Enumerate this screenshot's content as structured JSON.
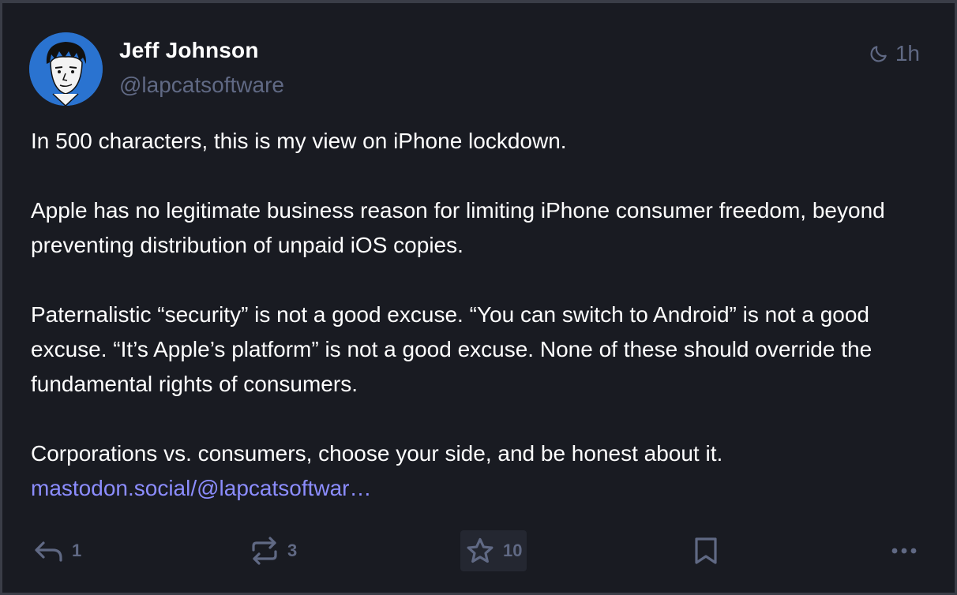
{
  "post": {
    "author": {
      "display_name": "Jeff Johnson",
      "handle": "@lapcatsoftware",
      "avatar_icon": "cartoon-face-avatar"
    },
    "visibility_icon": "moon-icon",
    "time": "1h",
    "paragraphs": [
      "In 500 characters, this is my view on iPhone lockdown.",
      "Apple has no legitimate business reason for limiting iPhone consumer freedom, beyond preventing distribution of unpaid iOS copies.",
      "Paternalistic “security” is not a good excuse. “You can switch to Android” is not a good excuse. “It’s Apple’s platform” is not a good excuse. None of these should override the fundamental rights of consumers.",
      "Corporations vs. consumers, choose your side, and be honest about it."
    ],
    "link_text": "mastodon.social/@lapcatsoftwar…",
    "actions": {
      "reply_count": "1",
      "boost_count": "3",
      "favourite_count": "10"
    }
  },
  "colors": {
    "background": "#191b22",
    "muted": "#606984",
    "link": "#8c8dff",
    "text": "#ffffff",
    "avatar_bg": "#2a73d0"
  }
}
